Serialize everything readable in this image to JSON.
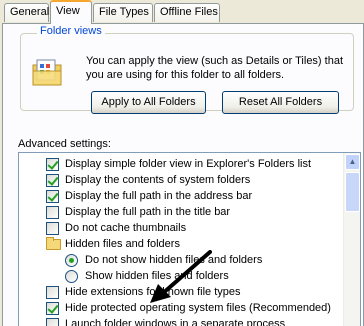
{
  "tabs": [
    {
      "label": "General"
    },
    {
      "label": "View"
    },
    {
      "label": "File Types"
    },
    {
      "label": "Offline Files"
    }
  ],
  "folder_views": {
    "title": "Folder views",
    "description": "You can apply the view (such as Details or Tiles) that you are using for this folder to all folders.",
    "apply_button": "Apply to All Folders",
    "reset_button": "Reset All Folders"
  },
  "advanced": {
    "label": "Advanced settings:",
    "items": [
      {
        "label": "Display simple folder view in Explorer's Folders list",
        "type": "checkbox",
        "checked": true
      },
      {
        "label": "Display the contents of system folders",
        "type": "checkbox",
        "checked": true
      },
      {
        "label": "Display the full path in the address bar",
        "type": "checkbox",
        "checked": true
      },
      {
        "label": "Display the full path in the title bar",
        "type": "checkbox",
        "checked": false
      },
      {
        "label": "Do not cache thumbnails",
        "type": "checkbox",
        "checked": false
      },
      {
        "label": "Hidden files and folders",
        "type": "folder"
      },
      {
        "label": "Do not show hidden files and folders",
        "type": "radio",
        "checked": true
      },
      {
        "label": "Show hidden files and folders",
        "type": "radio",
        "checked": false
      },
      {
        "label": "Hide extensions for known file types",
        "type": "checkbox",
        "checked": false
      },
      {
        "label": "Hide protected operating system files (Recommended)",
        "type": "checkbox",
        "checked": true
      },
      {
        "label": "Launch folder windows in a separate process",
        "type": "checkbox",
        "checked": false
      }
    ]
  }
}
